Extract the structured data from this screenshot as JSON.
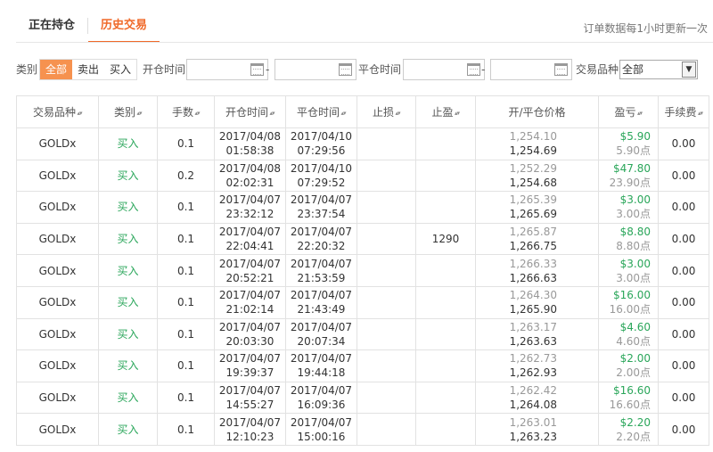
{
  "tabs": [
    {
      "label": "正在持仓",
      "active": false
    },
    {
      "label": "历史交易",
      "active": true
    }
  ],
  "update_note": "订单数据每1小时更新一次",
  "filter": {
    "type_label": "类别",
    "type_options": [
      "全部",
      "卖出",
      "买入"
    ],
    "type_selected": "全部",
    "open_time_label": "开仓时间",
    "close_time_label": "平仓时间",
    "dash": "-",
    "product_label": "交易品种",
    "product_value": "全部"
  },
  "table": {
    "headers": [
      "交易品种",
      "类别",
      "手数",
      "开仓时间",
      "平仓时间",
      "止损",
      "止盈",
      "开/平仓价格",
      "盈亏",
      "手续费"
    ],
    "rows": [
      {
        "product": "GOLDx",
        "type": "买入",
        "lots": "0.1",
        "open_date": "2017/04/08",
        "open_time": "01:58:38",
        "close_date": "2017/04/10",
        "close_time": "07:29:56",
        "sl": "",
        "tp": "",
        "open_price": "1,254.10",
        "close_price": "1,254.69",
        "pl": "$5.90",
        "pl_pts": "5.90点",
        "fee": "0.00"
      },
      {
        "product": "GOLDx",
        "type": "买入",
        "lots": "0.2",
        "open_date": "2017/04/08",
        "open_time": "02:02:31",
        "close_date": "2017/04/10",
        "close_time": "07:29:52",
        "sl": "",
        "tp": "",
        "open_price": "1,252.29",
        "close_price": "1,254.68",
        "pl": "$47.80",
        "pl_pts": "23.90点",
        "fee": "0.00"
      },
      {
        "product": "GOLDx",
        "type": "买入",
        "lots": "0.1",
        "open_date": "2017/04/07",
        "open_time": "23:32:12",
        "close_date": "2017/04/07",
        "close_time": "23:37:54",
        "sl": "",
        "tp": "",
        "open_price": "1,265.39",
        "close_price": "1,265.69",
        "pl": "$3.00",
        "pl_pts": "3.00点",
        "fee": "0.00"
      },
      {
        "product": "GOLDx",
        "type": "买入",
        "lots": "0.1",
        "open_date": "2017/04/07",
        "open_time": "22:04:41",
        "close_date": "2017/04/07",
        "close_time": "22:20:32",
        "sl": "",
        "tp": "1290",
        "open_price": "1,265.87",
        "close_price": "1,266.75",
        "pl": "$8.80",
        "pl_pts": "8.80点",
        "fee": "0.00"
      },
      {
        "product": "GOLDx",
        "type": "买入",
        "lots": "0.1",
        "open_date": "2017/04/07",
        "open_time": "20:52:21",
        "close_date": "2017/04/07",
        "close_time": "21:53:59",
        "sl": "",
        "tp": "",
        "open_price": "1,266.33",
        "close_price": "1,266.63",
        "pl": "$3.00",
        "pl_pts": "3.00点",
        "fee": "0.00"
      },
      {
        "product": "GOLDx",
        "type": "买入",
        "lots": "0.1",
        "open_date": "2017/04/07",
        "open_time": "21:02:14",
        "close_date": "2017/04/07",
        "close_time": "21:43:49",
        "sl": "",
        "tp": "",
        "open_price": "1,264.30",
        "close_price": "1,265.90",
        "pl": "$16.00",
        "pl_pts": "16.00点",
        "fee": "0.00"
      },
      {
        "product": "GOLDx",
        "type": "买入",
        "lots": "0.1",
        "open_date": "2017/04/07",
        "open_time": "20:03:30",
        "close_date": "2017/04/07",
        "close_time": "20:07:34",
        "sl": "",
        "tp": "",
        "open_price": "1,263.17",
        "close_price": "1,263.63",
        "pl": "$4.60",
        "pl_pts": "4.60点",
        "fee": "0.00"
      },
      {
        "product": "GOLDx",
        "type": "买入",
        "lots": "0.1",
        "open_date": "2017/04/07",
        "open_time": "19:39:37",
        "close_date": "2017/04/07",
        "close_time": "19:44:18",
        "sl": "",
        "tp": "",
        "open_price": "1,262.73",
        "close_price": "1,262.93",
        "pl": "$2.00",
        "pl_pts": "2.00点",
        "fee": "0.00"
      },
      {
        "product": "GOLDx",
        "type": "买入",
        "lots": "0.1",
        "open_date": "2017/04/07",
        "open_time": "14:55:27",
        "close_date": "2017/04/07",
        "close_time": "16:09:36",
        "sl": "",
        "tp": "",
        "open_price": "1,262.42",
        "close_price": "1,264.08",
        "pl": "$16.60",
        "pl_pts": "16.60点",
        "fee": "0.00"
      },
      {
        "product": "GOLDx",
        "type": "买入",
        "lots": "0.1",
        "open_date": "2017/04/07",
        "open_time": "12:10:23",
        "close_date": "2017/04/07",
        "close_time": "15:00:16",
        "sl": "",
        "tp": "",
        "open_price": "1,263.01",
        "close_price": "1,263.23",
        "pl": "$2.20",
        "pl_pts": "2.20点",
        "fee": "0.00"
      }
    ]
  },
  "colors": {
    "accent": "#f06a2a",
    "segment_active": "#f6924f",
    "profit": "#2aa65a",
    "muted": "#999999"
  }
}
